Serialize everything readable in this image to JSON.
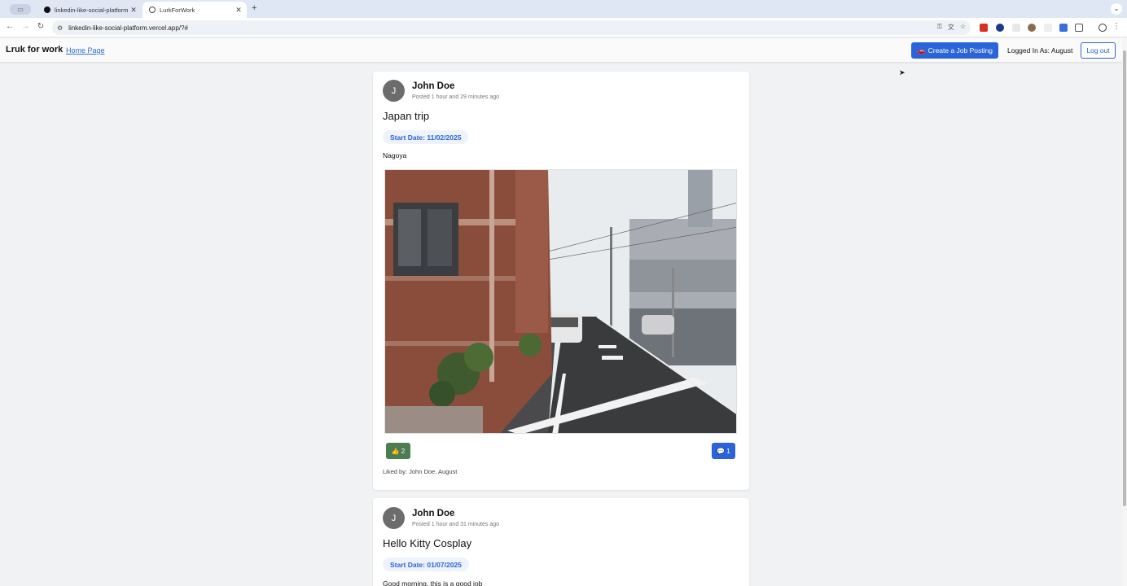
{
  "browser": {
    "tabs": [
      {
        "title": "linkedin-like-social-platform",
        "active": false
      },
      {
        "title": "LurkForWork",
        "active": true
      }
    ],
    "url": "linkedin-like-social-platform.vercel.app/?#"
  },
  "nav": {
    "brand": "Lruk for work",
    "home_link": "Home Page",
    "create_button": "Create a Job Posting",
    "logged_in_text": "Logged In As: August",
    "logout_button": "Log out"
  },
  "posts": [
    {
      "avatar_initial": "J",
      "author": "John Doe",
      "posted": "Posted 1 hour and 29 minutes ago",
      "title": "Japan trip",
      "start_date": "Start Date: 11/02/2025",
      "description": "Nagoya",
      "likes": "2",
      "comments": "1",
      "liked_by": "Liked by: John Doe, August"
    },
    {
      "avatar_initial": "J",
      "author": "John Doe",
      "posted": "Posted 1 hour and 31 minutes ago",
      "title": "Hello Kitty Cosplay",
      "start_date": "Start Date: 01/07/2025",
      "description": "Good morning, this is a good job"
    }
  ],
  "colors": {
    "primary": "#2a64d8",
    "like": "#4c7c52",
    "background": "#f1f2f4"
  }
}
